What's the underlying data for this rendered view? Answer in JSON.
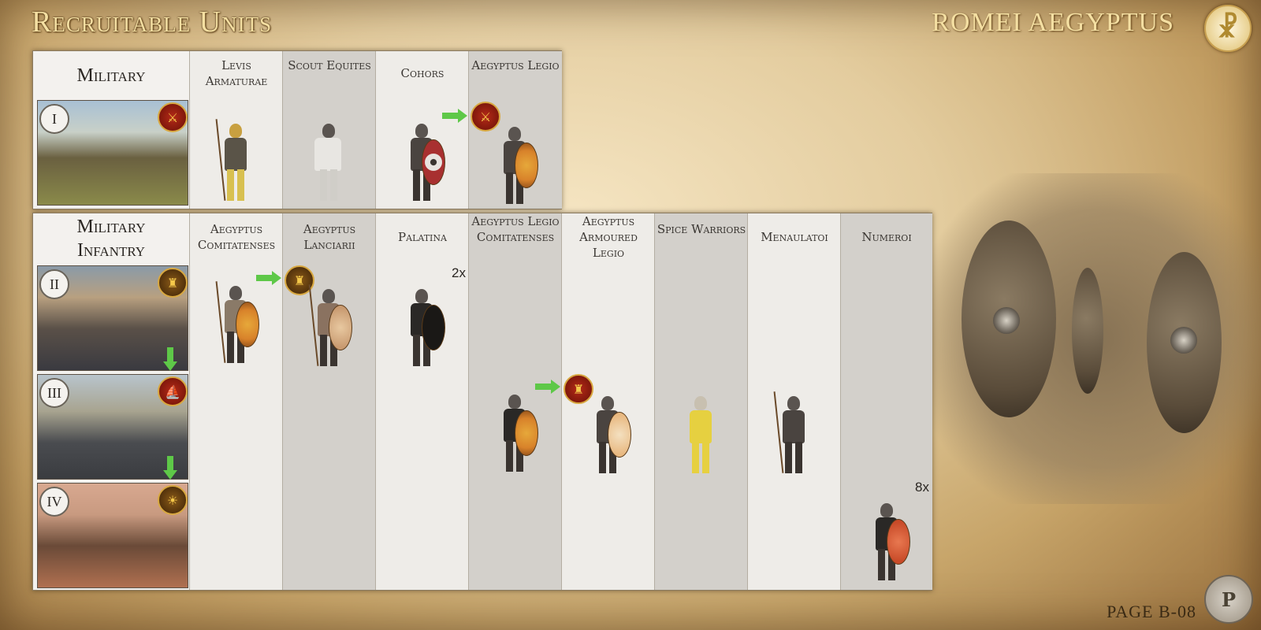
{
  "header": {
    "title": "Recruitable Units",
    "faction": "ROMEI AEGYPTUS",
    "faction_emblem_icon": "chi-rho-icon"
  },
  "footer": {
    "page": "PAGE B-08",
    "seal_icon": "mod-seal-icon"
  },
  "military": {
    "category": "Military",
    "tiers": [
      {
        "numeral": "I"
      }
    ],
    "units": [
      {
        "name": "Levis Armaturae"
      },
      {
        "name": "Scout Equites"
      },
      {
        "name": "Cohors"
      },
      {
        "name": "Aegyptus Legio"
      }
    ]
  },
  "infantry": {
    "category_line1": "Military",
    "category_line2": "Infantry",
    "tiers": [
      {
        "numeral": "II"
      },
      {
        "numeral": "III"
      },
      {
        "numeral": "IV"
      }
    ],
    "units": [
      {
        "name": "Aegyptus Comitatenses"
      },
      {
        "name": "Aegyptus Lanciarii"
      },
      {
        "name": "Palatina",
        "multiplier": "2x"
      },
      {
        "name": "Aegyptus Legio Comitatenses"
      },
      {
        "name": "Aegyptus Armoured Legio"
      },
      {
        "name": "Spice Warriors"
      },
      {
        "name": "Menaulatoi"
      },
      {
        "name": "Numeroi",
        "multiplier": "8x"
      }
    ]
  },
  "colors": {
    "arrow": "#5ec848",
    "title_gold": "#f4dfa2"
  }
}
